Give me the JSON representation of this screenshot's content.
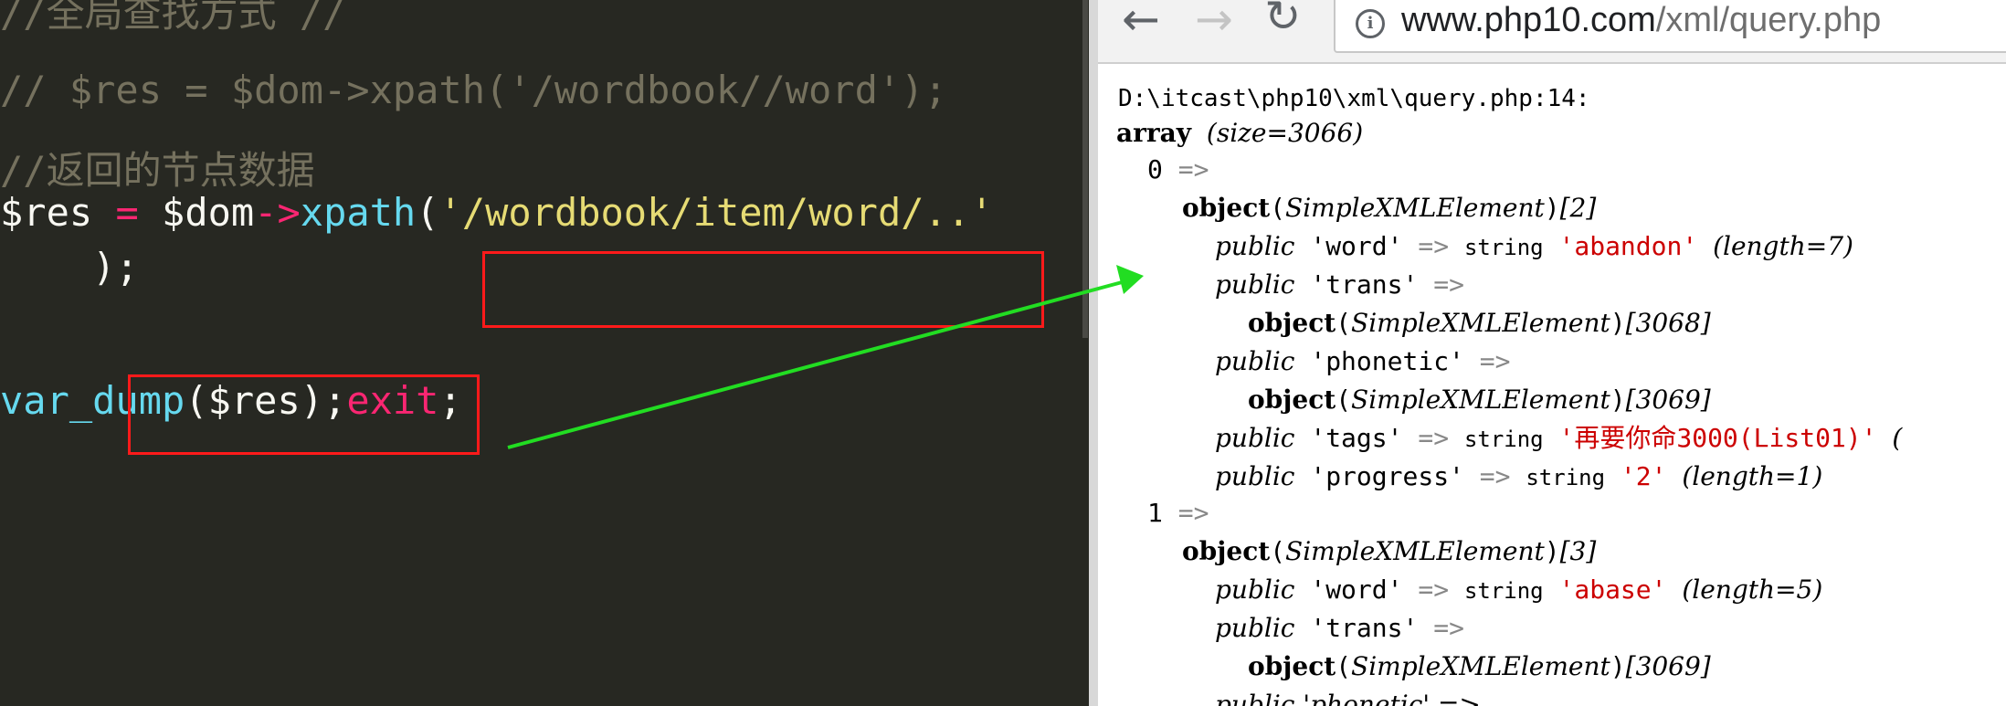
{
  "editor": {
    "comment1": "//全局查找方式 //",
    "comment2": "// $res = $dom->xpath('/wordbook//word');",
    "comment3": "//返回的节点数据",
    "line4": {
      "var": "$res",
      "eq": "=",
      "obj": "$dom",
      "arrow": "->",
      "fn": "xpath",
      "open": "(",
      "str": "'/wordbook/item/word/..'"
    },
    "line5": "    );",
    "line6": {
      "fn_a": "var_du",
      "fn_b": "mp",
      "args": "($res);",
      "kw": "exit",
      "semi": ";"
    }
  },
  "browser": {
    "url_host": "www.php10.com",
    "url_path": "/xml/query.php",
    "icons": {
      "back": "arrow-left-icon",
      "forward": "arrow-right-icon",
      "reload": "reload-icon",
      "info": "info-icon"
    }
  },
  "dump": {
    "path": "D:\\itcast\\php10\\xml\\query.php:14:",
    "array_kw": "array",
    "size": "(size=3066)",
    "arrow": "=>",
    "obj_kw": "object",
    "class": "SimpleXMLElement",
    "public_kw": "public",
    "string_kw": "string",
    "idx0": "0",
    "obj0_id": "[2]",
    "word0": "'abandon'",
    "word0_len": "(length=7)",
    "trans0_id": "[3068]",
    "phonetic0_id": "[3069]",
    "tags0": "'再要你命3000(List01)'",
    "tags0_trunc": "(",
    "progress0": "'2'",
    "progress0_len": "(length=1)",
    "idx1": "1",
    "obj1_id": "[3]",
    "word1": "'abase'",
    "word1_len": "(length=5)",
    "trans1_id": "[3069]",
    "phonetic1_label": "public 'phonetic' =>",
    "props": {
      "word": "'word'",
      "trans": "'trans'",
      "phonetic": "'phonetic'",
      "tags": "'tags'",
      "progress": "'progress'"
    }
  },
  "colors": {
    "editor_bg": "#272822",
    "highlight": "#ff1a1a",
    "arrow": "#22dd22",
    "dump_red": "#cc0000"
  }
}
